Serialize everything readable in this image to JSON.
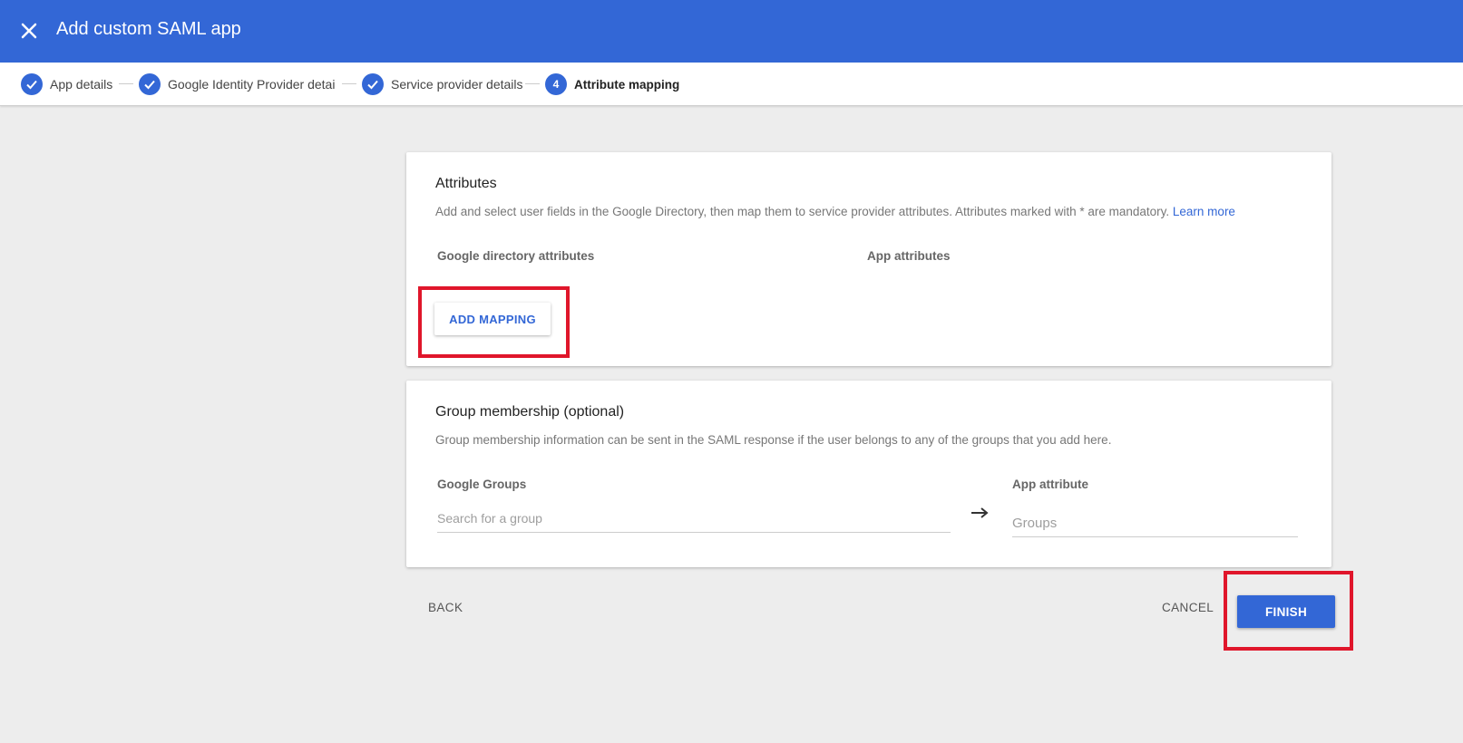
{
  "header": {
    "title": "Add custom SAML app",
    "close_icon": "close-icon",
    "background_color": "#3367d6"
  },
  "stepper": {
    "steps": [
      {
        "label": "App details",
        "state": "completed",
        "icon": "check-icon"
      },
      {
        "label": "Google Identity Provider details",
        "state": "completed",
        "icon": "check-icon"
      },
      {
        "label": "Service provider details",
        "state": "completed",
        "icon": "check-icon"
      },
      {
        "label": "Attribute mapping",
        "state": "active",
        "number": "4"
      }
    ]
  },
  "attributes": {
    "title": "Attributes",
    "description": "Add and select user fields in the Google Directory, then map them to service provider attributes. Attributes marked with * are mandatory.",
    "learn_more": "Learn more",
    "col_directory": "Google directory attributes",
    "col_app": "App attributes",
    "add_mapping_label": "ADD MAPPING"
  },
  "groups": {
    "title": "Group membership (optional)",
    "description": "Group membership information can be sent in the SAML response if the user belongs to any of the groups that you add here.",
    "col_groups": "Google Groups",
    "col_app_attribute": "App attribute",
    "search_placeholder": "Search for a group",
    "app_attribute_placeholder": "Groups",
    "arrow_icon": "arrow-right-icon"
  },
  "footer": {
    "back_label": "BACK",
    "cancel_label": "CANCEL",
    "finish_label": "FINISH"
  },
  "colors": {
    "accent": "#3367d6",
    "highlight": "#e0162b",
    "background": "#ededed"
  }
}
